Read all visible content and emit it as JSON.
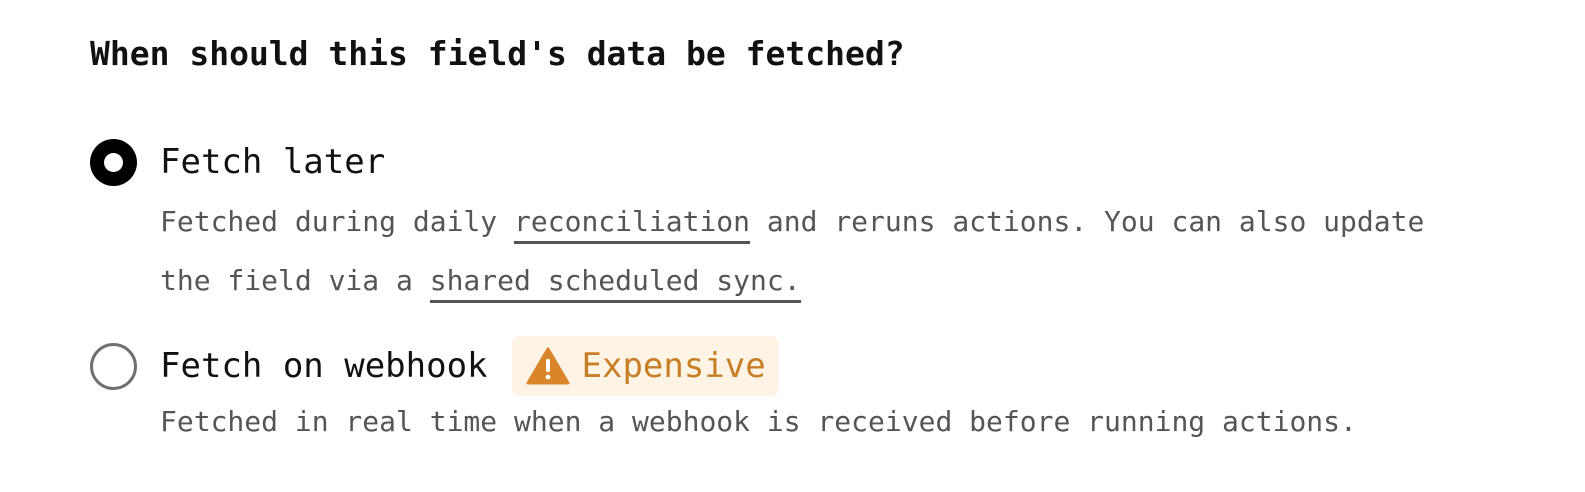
{
  "question": "When should this field's data be fetched?",
  "options": [
    {
      "label": "Fetch later",
      "selected": true,
      "description": {
        "line1_prefix": "Fetched during daily ",
        "link1": "reconciliation",
        "line1_suffix": " and reruns actions. You can also update",
        "line2_prefix": "the field via a ",
        "link2": "shared scheduled sync."
      }
    },
    {
      "label": "Fetch on webhook",
      "selected": false,
      "badge": {
        "icon": "warning-icon",
        "label": "Expensive",
        "color": "#c87f24",
        "background": "#fdf4e6"
      },
      "description": {
        "text": "Fetched in real time when a webhook is received before running actions."
      }
    }
  ]
}
